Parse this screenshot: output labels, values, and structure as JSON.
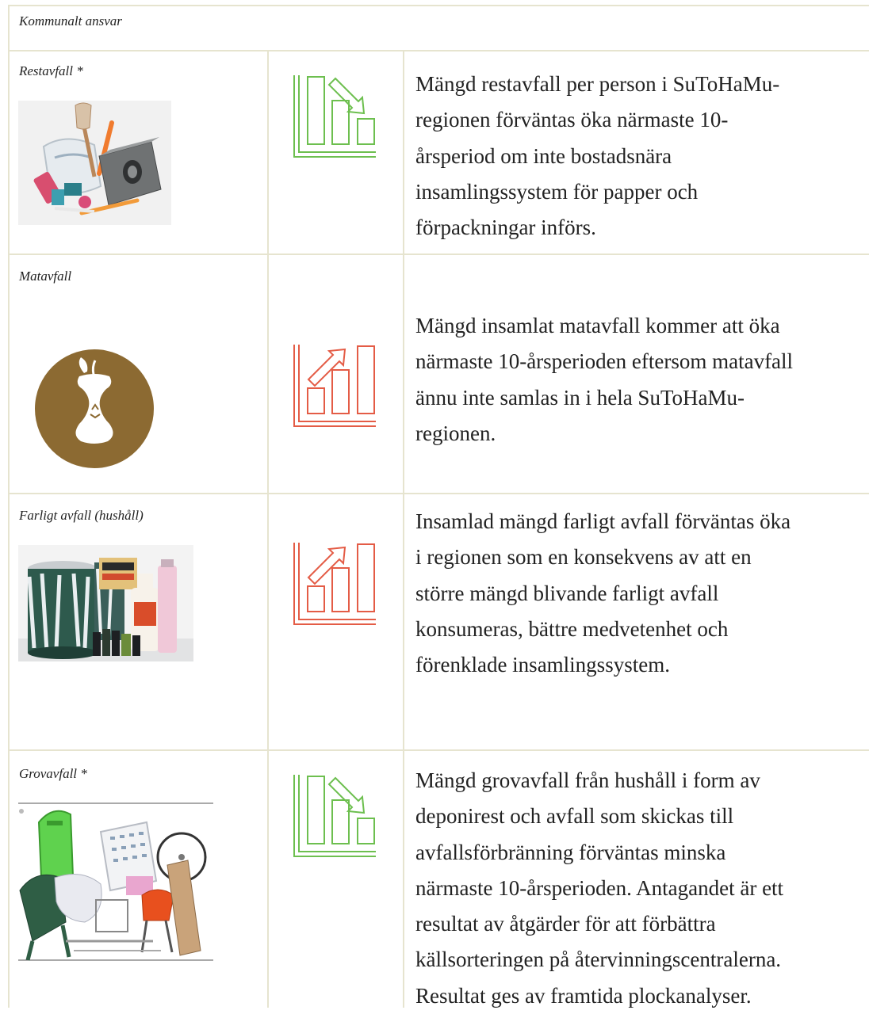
{
  "header": {
    "title": "Kommunalt ansvar"
  },
  "rows": [
    {
      "label": "Restavfall *",
      "trend": "decrease",
      "description": "Mängd restavfall per person i SuToHaMu-\nregionen förväntas öka närmaste 10-\nårsperiod om inte bostadsnära\ninsamlingssystem för papper och\nförpackningar införs."
    },
    {
      "label": "Matavfall",
      "trend": "increase",
      "description": "Mängd insamlat matavfall kommer att öka\nnärmaste 10-årsperioden eftersom matavfall\nännu inte samlas in i hela SuToHaMu-\nregionen."
    },
    {
      "label": "Farligt avfall (hushåll)",
      "trend": "increase",
      "description": "Insamlad mängd farligt avfall förväntas öka\ni regionen som en konsekvens av att en\nstörre mängd blivande farligt avfall\nkonsumeras, bättre medvetenhet och\nförenklade insamlingssystem."
    },
    {
      "label": "Grovavfall *",
      "trend": "decrease",
      "description": "Mängd grovavfall från hushåll i form av\ndeponirest och avfall som skickas till\navfallsförbränning förväntas minska\nnärmaste 10-årsperioden. Antagandet är ett\nresultat av åtgärder för att förbättra\nkällsorteringen på återvinningscentralerna.\nResultat ges av framtida plockanalyser."
    }
  ],
  "colors": {
    "decrease": "#6dbf4f",
    "increase": "#e45c46",
    "border": "#e6e4cf",
    "food_icon_bg": "#8c6a32"
  },
  "icons": [
    "trend-down-icon",
    "trend-up-icon",
    "apple-core-icon"
  ]
}
